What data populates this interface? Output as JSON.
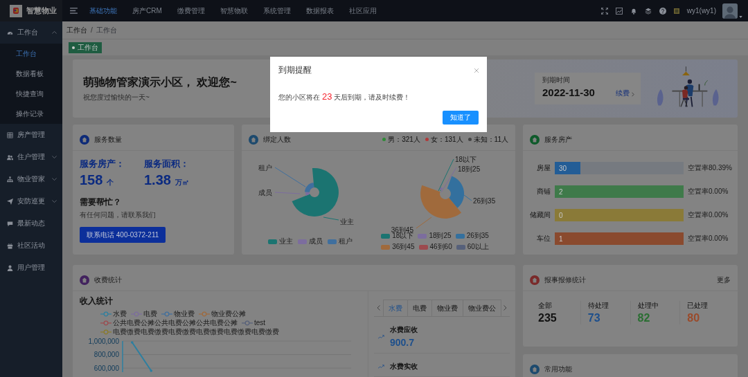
{
  "topbar": {
    "brand": "智慧物业",
    "nav": [
      {
        "label": "基础功能",
        "selected": true
      },
      {
        "label": "房产CRM",
        "selected": false
      },
      {
        "label": "缴费管理",
        "selected": false
      },
      {
        "label": "智慧物联",
        "selected": false
      },
      {
        "label": "系统管理",
        "selected": false
      },
      {
        "label": "数据报表",
        "selected": false
      },
      {
        "label": "社区应用",
        "selected": false
      }
    ],
    "user": "wy1(wy1)"
  },
  "sidebar": {
    "items": [
      {
        "label": "工作台",
        "expanded": true,
        "children": [
          {
            "label": "工作台",
            "selected": true
          },
          {
            "label": "数据看板",
            "selected": false
          },
          {
            "label": "快捷查询",
            "selected": false
          },
          {
            "label": "操作记录",
            "selected": false
          }
        ]
      },
      {
        "label": "房产管理"
      },
      {
        "label": "住户管理",
        "expanded": false
      },
      {
        "label": "物业管家",
        "expanded": false
      },
      {
        "label": "安防巡更",
        "expanded": false
      },
      {
        "label": "最新动态"
      },
      {
        "label": "社区活动"
      },
      {
        "label": "用户管理"
      }
    ]
  },
  "breadcrumb": [
    "工作台",
    "工作台"
  ],
  "breadcrumb_separator": "/",
  "tag": "工作台",
  "welcome": {
    "title": "萌驰物管家演示小区， 欢迎您~",
    "subtitle": "祝您度过愉快的一天~",
    "expiry_label": "到期时间",
    "expiry_date": "2022-11-30",
    "renew_link": "续费"
  },
  "service_count": {
    "title": "服务数量",
    "stats": [
      {
        "label": "服务房产：",
        "value": "158",
        "unit": "个"
      },
      {
        "label": "服务面积：",
        "value": "1.38",
        "unit": "万㎡"
      }
    ],
    "help_title": "需要帮忙？",
    "help_text": "有任何问题，请联系我们",
    "contact_button": "联系电话 400-0372-211"
  },
  "binding": {
    "title": "绑定人数",
    "genders": [
      {
        "label": "男：321人",
        "color": "#2e8a36"
      },
      {
        "label": "女：131人",
        "color": "#b03a3a"
      },
      {
        "label": "未知：11人",
        "color": "#444444"
      }
    ],
    "role_callouts": [
      {
        "label": "租户",
        "color": "#3f6f9e"
      },
      {
        "label": "成员",
        "color": "#7c6d9e"
      },
      {
        "label": "业主",
        "color": "#1b7471"
      }
    ],
    "role_legend": [
      {
        "label": "业主",
        "color": "#1b7471"
      },
      {
        "label": "成员",
        "color": "#7c6d9e"
      },
      {
        "label": "租户",
        "color": "#3f6f9e"
      }
    ],
    "age_callouts": [
      {
        "label": "18以下",
        "color": "#1b7471"
      },
      {
        "label": "18到25",
        "color": "#7c6d9e"
      },
      {
        "label": "26到35",
        "color": "#33709e"
      },
      {
        "label": "36到45",
        "color": "#a06a3c"
      }
    ],
    "age_legend": [
      {
        "label": "18以下",
        "color": "#1b7471"
      },
      {
        "label": "18到25",
        "color": "#7c6d9e"
      },
      {
        "label": "26到35",
        "color": "#33709e"
      },
      {
        "label": "36到45",
        "color": "#a06a3c"
      },
      {
        "label": "46到60",
        "color": "#9c4a4e"
      },
      {
        "label": "60以上",
        "color": "#56607a"
      }
    ]
  },
  "property": {
    "title": "服务房产",
    "rows": [
      {
        "label": "房屋",
        "value": "30",
        "level": 0.2,
        "vacancy": "空置率80.39%",
        "color": "#235d96"
      },
      {
        "label": "商铺",
        "value": "2",
        "level": 1,
        "vacancy": "空置率0.00%",
        "color": "#3f7a4a"
      },
      {
        "label": "储藏间",
        "value": "0",
        "level": 1,
        "vacancy": "空置率0.00%",
        "color": "#8a7a38"
      },
      {
        "label": "车位",
        "value": "1",
        "level": 1,
        "vacancy": "空置率0.00%",
        "color": "#8a4a2e"
      }
    ]
  },
  "fees": {
    "title": "收费统计",
    "chart_title": "收入统计",
    "chart_data": {
      "type": "line",
      "grid": true,
      "categories": [
        null,
        null,
        null,
        null,
        null,
        null,
        null,
        null,
        null,
        null,
        null,
        null
      ],
      "ylim": [
        540000,
        1000000
      ],
      "yticks": [
        {
          "value": 600000,
          "label": "600,000"
        },
        {
          "value": 800000,
          "label": "800,000"
        },
        {
          "value": 1000000,
          "label": "1,000,000"
        }
      ],
      "series": [
        {
          "name": "水费",
          "color": "#2d7fa0",
          "values": [
            980000,
            560000,
            null,
            null,
            null,
            null,
            null,
            null,
            null,
            null,
            null,
            null
          ]
        },
        {
          "name": "电费",
          "color": "#7c6d9e",
          "values": [
            null,
            null,
            null,
            null,
            null,
            null,
            null,
            null,
            null,
            null,
            null,
            null
          ]
        },
        {
          "name": "物业费",
          "color": "#3f6f9e",
          "values": [
            null,
            null,
            null,
            null,
            null,
            null,
            null,
            null,
            null,
            null,
            null,
            null
          ]
        },
        {
          "name": "物业费公摊",
          "color": "#a06a3c",
          "values": [
            null,
            null,
            null,
            null,
            null,
            null,
            null,
            null,
            null,
            null,
            null,
            null
          ]
        },
        {
          "name": "公共电费公摊公共电费公摊公共电费公摊",
          "color": "#9c4a4e",
          "values": [
            null,
            null,
            null,
            null,
            null,
            null,
            null,
            null,
            null,
            null,
            null,
            null
          ]
        },
        {
          "name": "test",
          "color": "#56607a",
          "values": [
            null,
            null,
            null,
            null,
            null,
            null,
            null,
            null,
            null,
            null,
            null,
            null
          ]
        },
        {
          "name": "电费缴费电费缴费电费缴费电费缴费电费缴费电费缴费",
          "color": "#8a7a2a",
          "values": [
            null,
            null,
            null,
            null,
            null,
            null,
            null,
            null,
            null,
            null,
            null,
            null
          ]
        }
      ]
    },
    "tabs": [
      {
        "label": "水费",
        "selected": true
      },
      {
        "label": "电费",
        "selected": false
      },
      {
        "label": "物业费",
        "selected": false
      },
      {
        "label": "物业费公",
        "selected": false
      }
    ],
    "items": [
      {
        "label": "水费应收",
        "value": "900.7"
      },
      {
        "label": "水费实收"
      }
    ]
  },
  "repairs": {
    "title": "报事报修统计",
    "more": "更多",
    "stats": [
      {
        "label": "全部",
        "value": "235",
        "color": "#111111"
      },
      {
        "label": "待处理",
        "value": "73",
        "color": "#1d4f8c"
      },
      {
        "label": "处理中",
        "value": "82",
        "color": "#2a6e32"
      },
      {
        "label": "已处理",
        "value": "80",
        "color": "#9a4a2a"
      }
    ]
  },
  "common": {
    "title": "常用功能"
  },
  "modal": {
    "title": "到期提醒",
    "message_before": "您的小区将在",
    "days": "23",
    "message_after": "天后到期，请及时续费！",
    "button": "知道了"
  }
}
